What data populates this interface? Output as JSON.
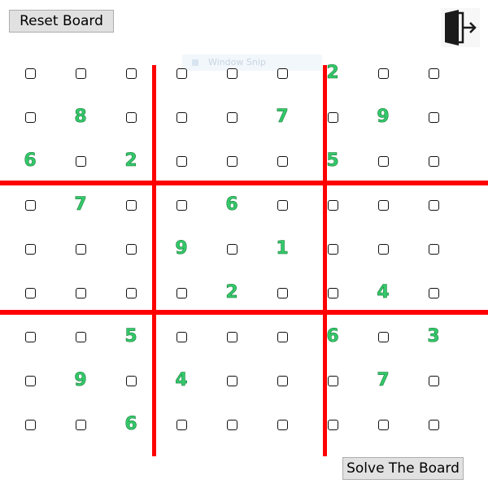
{
  "toolbar": {
    "reset_label": "Reset Board",
    "solve_label": "Solve The Board",
    "exit_icon": "exit-door-icon"
  },
  "overlay": {
    "ghost_text": "Window Snip"
  },
  "colors": {
    "grid_rule": "#ff0000",
    "given_number": "#34c96a",
    "checkbox_border": "#111111"
  },
  "board": {
    "size": 9,
    "cells": [
      [
        "",
        "",
        "",
        "",
        "",
        "",
        "2",
        "",
        ""
      ],
      [
        "",
        "8",
        "",
        "",
        "",
        "7",
        "",
        "9",
        ""
      ],
      [
        "6",
        "",
        "2",
        "",
        "",
        "",
        "5",
        "",
        ""
      ],
      [
        "",
        "7",
        "",
        "",
        "6",
        "",
        "",
        "",
        ""
      ],
      [
        "",
        "",
        "",
        "9",
        "",
        "1",
        "",
        "",
        ""
      ],
      [
        "",
        "",
        "",
        "",
        "2",
        "",
        "",
        "4",
        ""
      ],
      [
        "",
        "",
        "5",
        "",
        "",
        "",
        "6",
        "",
        "3"
      ],
      [
        "",
        "9",
        "",
        "4",
        "",
        "",
        "",
        "7",
        ""
      ],
      [
        "",
        "",
        "6",
        "",
        "",
        "",
        "",
        "",
        ""
      ]
    ]
  }
}
